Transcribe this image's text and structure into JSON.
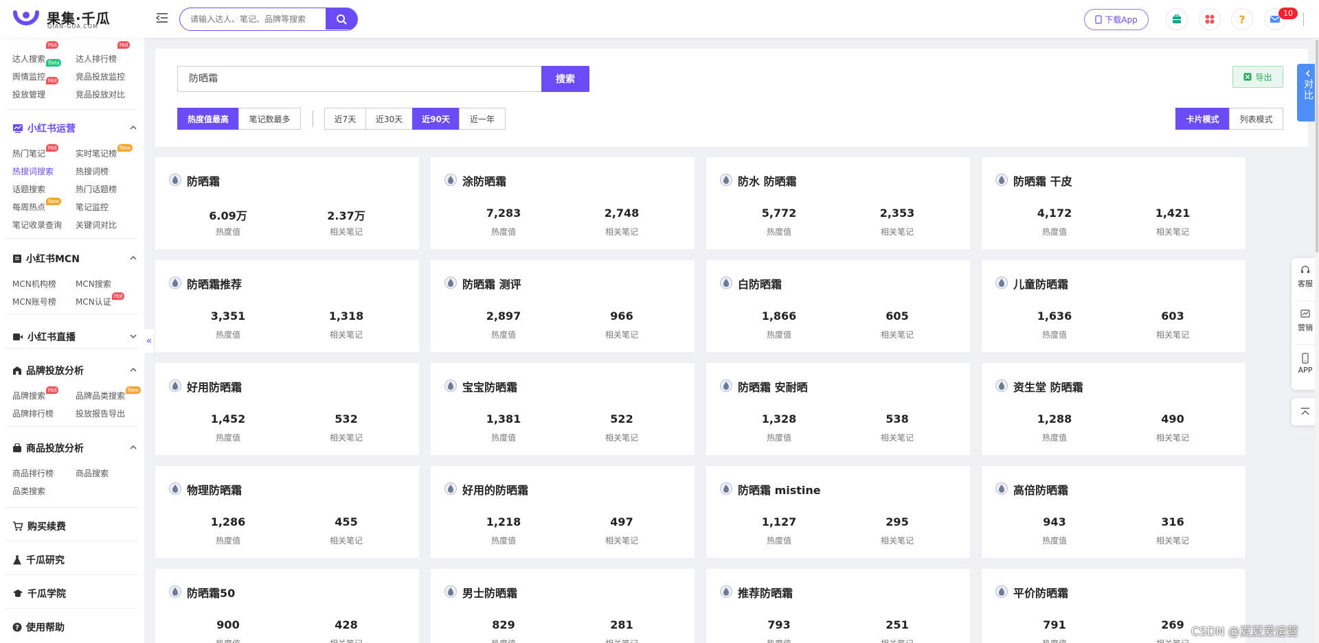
{
  "header": {
    "logo_text": "果集·千瓜",
    "logo_sub": "QIAN-GUA.COM",
    "search_placeholder": "请输入达人、笔记、品牌等搜索",
    "download_app": "下载App",
    "notification_count": "10"
  },
  "sidebar": {
    "top_links": [
      {
        "label": "达人搜索",
        "tag": "Hot"
      },
      {
        "label": "达人排行榜",
        "tag": "Hot"
      },
      {
        "label": "舆情监控",
        "tag": "Beta"
      },
      {
        "label": "竞品投放监控",
        "tag": ""
      },
      {
        "label": "投放管理",
        "tag": "Hot"
      },
      {
        "label": "竞品投放对比",
        "tag": ""
      }
    ],
    "sections": [
      {
        "title": "小红书运营",
        "links": [
          {
            "label": "热门笔记",
            "tag": "Hot"
          },
          {
            "label": "实时笔记榜",
            "tag": "New"
          },
          {
            "label": "热搜词搜索",
            "tag": ""
          },
          {
            "label": "热搜词榜",
            "tag": ""
          },
          {
            "label": "话题搜索",
            "tag": ""
          },
          {
            "label": "热门话题榜",
            "tag": ""
          },
          {
            "label": "每周热点",
            "tag": "New"
          },
          {
            "label": "笔记监控",
            "tag": ""
          },
          {
            "label": "笔记收录查询",
            "tag": ""
          },
          {
            "label": "关键词对比",
            "tag": ""
          }
        ]
      },
      {
        "title": "小红书MCN",
        "links": [
          {
            "label": "MCN机构榜",
            "tag": ""
          },
          {
            "label": "MCN搜索",
            "tag": ""
          },
          {
            "label": "MCN账号榜",
            "tag": ""
          },
          {
            "label": "MCN认证",
            "tag": "Hot"
          }
        ]
      },
      {
        "title": "小红书直播",
        "links": []
      },
      {
        "title": "品牌投放分析",
        "links": [
          {
            "label": "品牌搜索",
            "tag": "Hot"
          },
          {
            "label": "品牌品类搜索",
            "tag": "New"
          },
          {
            "label": "品牌排行榜",
            "tag": ""
          },
          {
            "label": "投放报告导出",
            "tag": ""
          }
        ]
      },
      {
        "title": "商品投放分析",
        "links": [
          {
            "label": "商品排行榜",
            "tag": ""
          },
          {
            "label": "商品搜索",
            "tag": ""
          },
          {
            "label": "品类搜索",
            "tag": ""
          }
        ]
      }
    ],
    "bottom_items": [
      "购买续费",
      "千瓜研究",
      "千瓜学院",
      "使用帮助"
    ]
  },
  "main": {
    "keyword": "防晒霜",
    "search_button": "搜索",
    "export_button": "导出",
    "sort_options": [
      "热度值最高",
      "笔记数最多"
    ],
    "sort_selected": "热度值最高",
    "range_options": [
      "近7天",
      "近30天",
      "近90天",
      "近一年"
    ],
    "range_selected": "近90天",
    "view_options": [
      "卡片模式",
      "列表模式"
    ],
    "view_selected": "卡片模式",
    "heat_label": "热度值",
    "notes_label": "相关笔记",
    "cards": [
      {
        "keyword": "防晒霜",
        "heat": "6.09万",
        "notes": "2.37万"
      },
      {
        "keyword": "涂防晒霜",
        "heat": "7,283",
        "notes": "2,748"
      },
      {
        "keyword": "防水 防晒霜",
        "heat": "5,772",
        "notes": "2,353"
      },
      {
        "keyword": "防晒霜 干皮",
        "heat": "4,172",
        "notes": "1,421"
      },
      {
        "keyword": "防晒霜推荐",
        "heat": "3,351",
        "notes": "1,318"
      },
      {
        "keyword": "防晒霜 测评",
        "heat": "2,897",
        "notes": "966"
      },
      {
        "keyword": "白防晒霜",
        "heat": "1,866",
        "notes": "605"
      },
      {
        "keyword": "儿童防晒霜",
        "heat": "1,636",
        "notes": "603"
      },
      {
        "keyword": "好用防晒霜",
        "heat": "1,452",
        "notes": "532"
      },
      {
        "keyword": "宝宝防晒霜",
        "heat": "1,381",
        "notes": "522"
      },
      {
        "keyword": "防晒霜 安耐晒",
        "heat": "1,328",
        "notes": "538"
      },
      {
        "keyword": "资生堂 防晒霜",
        "heat": "1,288",
        "notes": "490"
      },
      {
        "keyword": "物理防晒霜",
        "heat": "1,286",
        "notes": "455"
      },
      {
        "keyword": "好用的防晒霜",
        "heat": "1,218",
        "notes": "497"
      },
      {
        "keyword": "防晒霜 mistine",
        "heat": "1,127",
        "notes": "295"
      },
      {
        "keyword": "高倍防晒霜",
        "heat": "943",
        "notes": "316"
      },
      {
        "keyword": "防晒霜50",
        "heat": "900",
        "notes": "428"
      },
      {
        "keyword": "男士防晒霜",
        "heat": "829",
        "notes": "281"
      },
      {
        "keyword": "推荐防晒霜",
        "heat": "793",
        "notes": "251"
      },
      {
        "keyword": "平价防晒霜",
        "heat": "791",
        "notes": "269"
      }
    ]
  },
  "right_float": {
    "compare": "对比",
    "items": [
      "客服",
      "营销",
      "APP"
    ]
  },
  "watermark": "CSDN @夏夏爱运营",
  "colors": {
    "accent": "#6a4cf5",
    "hot": "#f5525c",
    "new": "#f7a531",
    "beta": "#14c77a",
    "export": "#27a75a",
    "compare": "#4d8ff7"
  }
}
